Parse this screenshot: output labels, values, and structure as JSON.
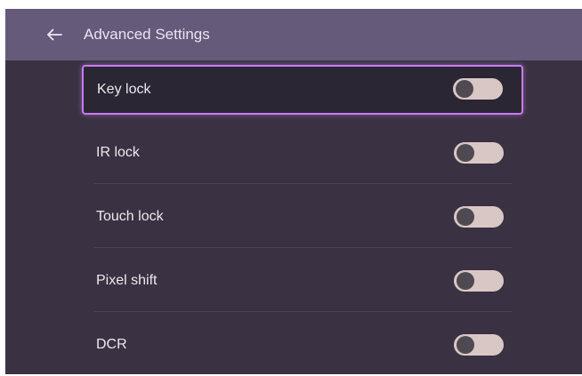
{
  "header": {
    "back_icon": "arrow-left-icon",
    "title": "Advanced Settings"
  },
  "settings": [
    {
      "label": "Key lock",
      "enabled": false,
      "focused": true
    },
    {
      "label": "IR lock",
      "enabled": false,
      "focused": false
    },
    {
      "label": "Touch lock",
      "enabled": false,
      "focused": false
    },
    {
      "label": "Pixel shift",
      "enabled": false,
      "focused": false
    },
    {
      "label": "DCR",
      "enabled": false,
      "focused": false
    }
  ],
  "colors": {
    "header_bg": "#655a7a",
    "panel_bg": "#3a3242",
    "focus_border": "#c77bf0",
    "toggle_track": "#d9c7c5",
    "toggle_knob": "#4f4a52"
  }
}
